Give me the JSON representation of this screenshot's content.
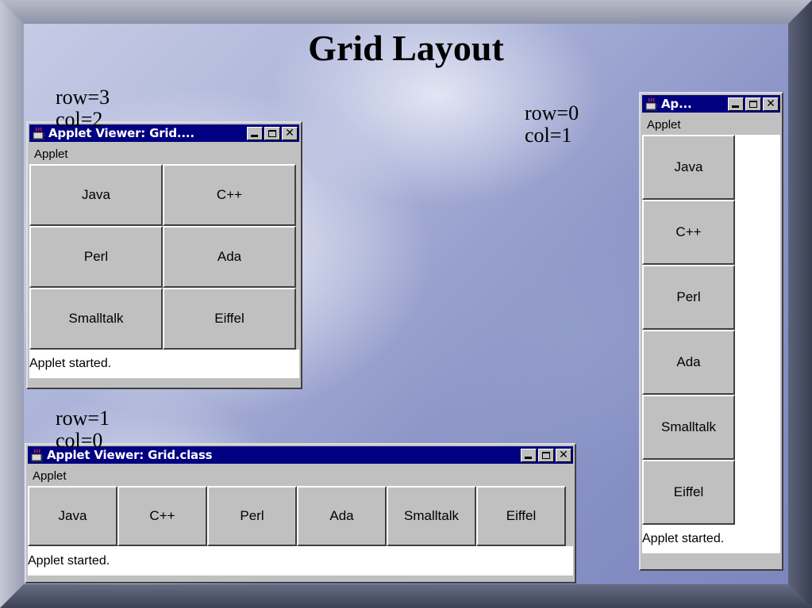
{
  "slide": {
    "title": "Grid Layout"
  },
  "captions": {
    "grid32": "row=3\ncol=2",
    "grid01": "row=0\ncol=1",
    "grid10": "row=1\ncol=0"
  },
  "windows": {
    "grid32": {
      "title": "Applet Viewer: Grid....",
      "menu": "Applet",
      "buttons": [
        "Java",
        "C++",
        "Perl",
        "Ada",
        "Smalltalk",
        "Eiffel"
      ],
      "status": "Applet started."
    },
    "grid01": {
      "title": "Ap...",
      "menu": "Applet",
      "buttons": [
        "Java",
        "C++",
        "Perl",
        "Ada",
        "Smalltalk",
        "Eiffel"
      ],
      "status": "Applet started."
    },
    "grid10": {
      "title": "Applet Viewer: Grid.class",
      "menu": "Applet",
      "buttons": [
        "Java",
        "C++",
        "Perl",
        "Ada",
        "Smalltalk",
        "Eiffel"
      ],
      "status": "Applet started."
    }
  },
  "icons": {
    "app": "java-cup-icon",
    "minimize": "minimize-icon",
    "maximize": "maximize-icon",
    "close": "close-icon"
  },
  "colors": {
    "titlebar": "#000080",
    "window": "#c0c0c0"
  }
}
